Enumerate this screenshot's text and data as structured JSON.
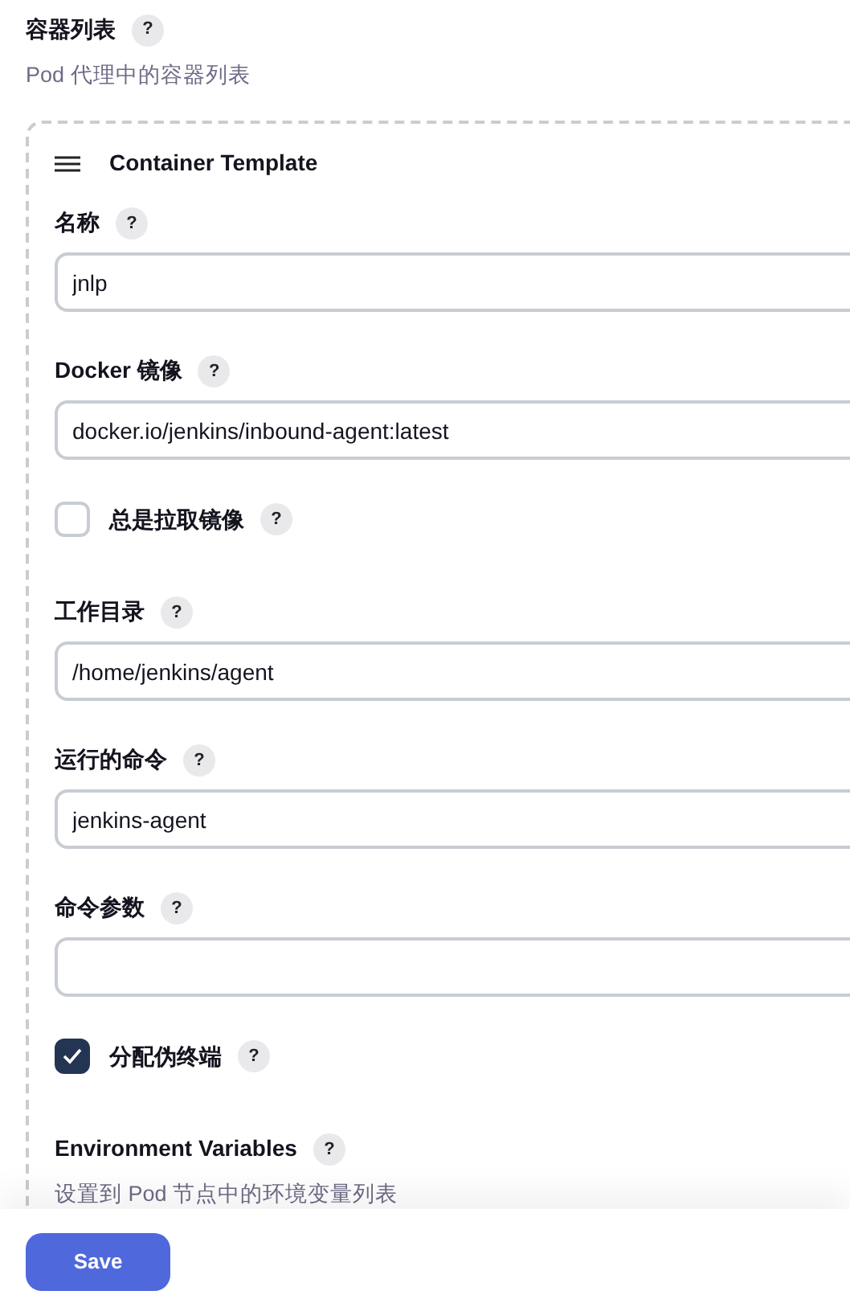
{
  "section": {
    "title": "容器列表",
    "help": "?",
    "description": "Pod 代理中的容器列表"
  },
  "template": {
    "title": "Container Template",
    "fields": [
      {
        "kind": "text",
        "label": "名称",
        "help": "?",
        "value": "jnlp"
      },
      {
        "kind": "text",
        "label": "Docker 镜像",
        "help": "?",
        "value": "docker.io/jenkins/inbound-agent:latest"
      },
      {
        "kind": "checkbox",
        "label": "总是拉取镜像",
        "help": "?",
        "checked": false
      },
      {
        "kind": "text",
        "label": "工作目录",
        "help": "?",
        "value": "/home/jenkins/agent"
      },
      {
        "kind": "text",
        "label": "运行的命令",
        "help": "?",
        "value": "jenkins-agent"
      },
      {
        "kind": "text",
        "label": "命令参数",
        "help": "?"
      },
      {
        "kind": "checkbox",
        "label": "分配伪终端",
        "help": "?",
        "checked": true
      },
      {
        "kind": "section",
        "label": "Environment Variables",
        "help": "?",
        "description": "设置到 Pod 节点中的环境变量列表"
      }
    ]
  },
  "footer": {
    "save": "Save"
  }
}
